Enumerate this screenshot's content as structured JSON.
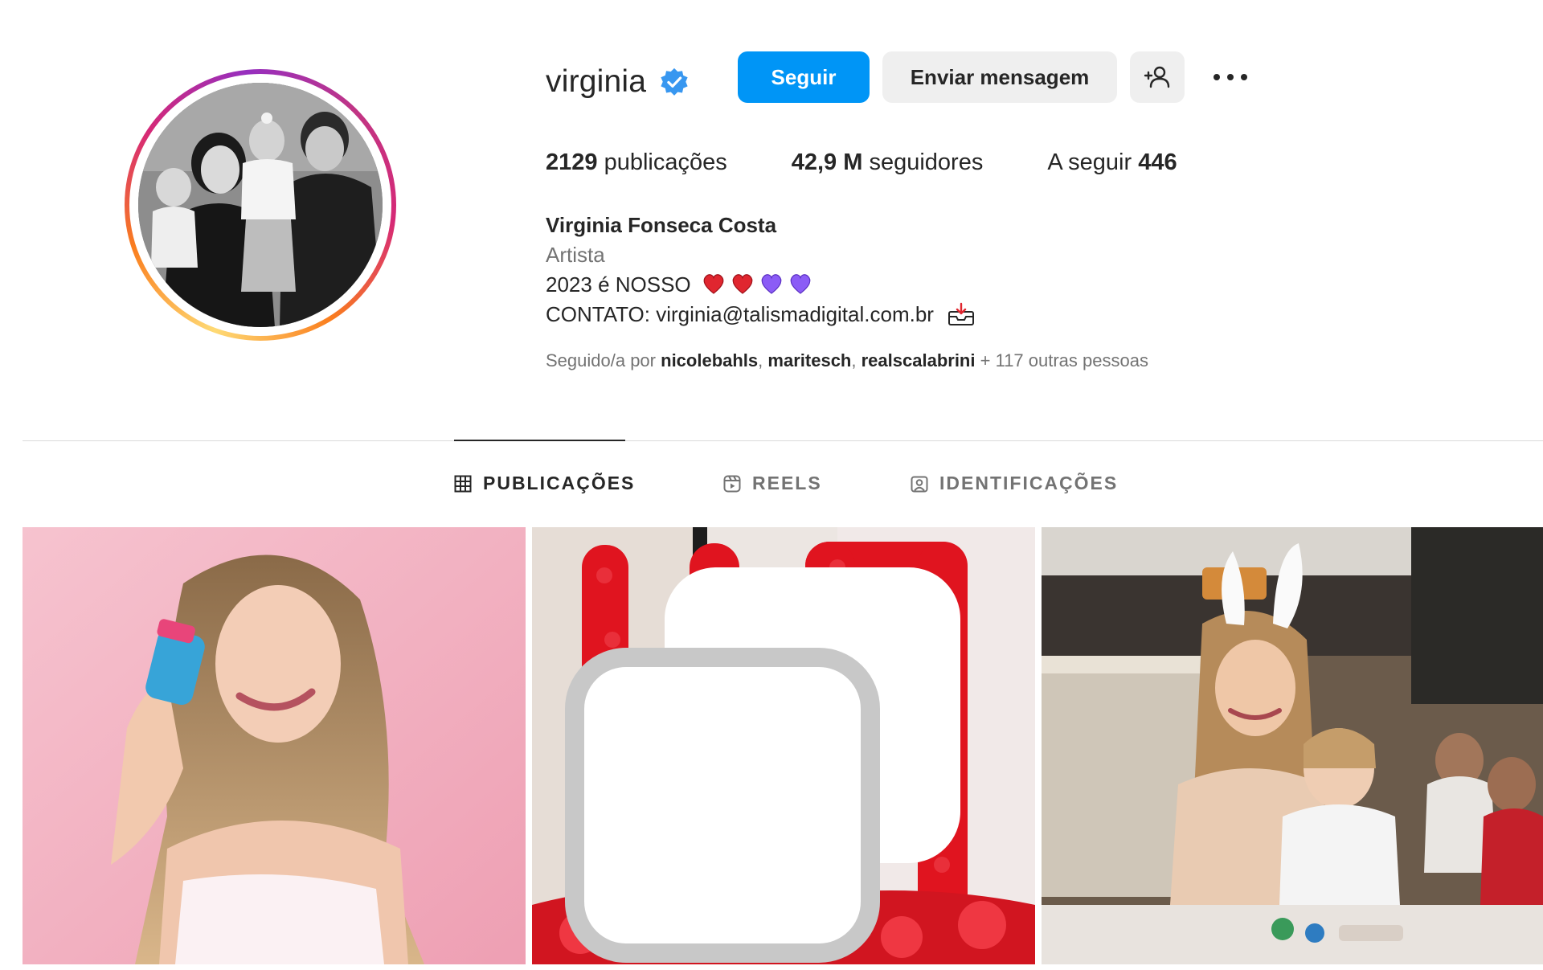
{
  "profile": {
    "username": "virginia",
    "verified": true,
    "full_name": "Virginia Fonseca Costa",
    "category": "Artista",
    "bio_line1": "2023 é NOSSO",
    "bio_contact": "CONTATO: virginia@talismadigital.com.br",
    "avatar_icon": "family-photo-avatar"
  },
  "actions": {
    "follow_label": "Seguir",
    "message_label": "Enviar mensagem",
    "suggest_icon": "add-person-icon",
    "more_icon": "more-options-icon"
  },
  "stats": {
    "posts_count": "2129",
    "posts_label": "publicações",
    "followers_count": "42,9 M",
    "followers_label": "seguidores",
    "following_label": "A seguir",
    "following_count": "446"
  },
  "followed_by": {
    "prefix": "Seguido/a por",
    "user1": "nicolebahls",
    "sep1": ",",
    "user2": "maritesch",
    "sep2": ",",
    "user3": "realscalabrini",
    "suffix": "+ 117 outras pessoas"
  },
  "tabs": [
    {
      "label": "PUBLICAÇÕES",
      "icon": "grid-icon",
      "active": true
    },
    {
      "label": "REELS",
      "icon": "reels-icon",
      "active": false
    },
    {
      "label": "IDENTIFICAÇÕES",
      "icon": "tagged-icon",
      "active": false
    }
  ],
  "posts": [
    {
      "subject": "pink-product-portrait",
      "carousel": false
    },
    {
      "subject": "red-balloon-numbers",
      "carousel": true
    },
    {
      "subject": "family-easter-kitchen",
      "carousel": false
    }
  ],
  "colors": {
    "accent": "#0095f6",
    "text": "#262626",
    "muted": "#737373",
    "button_bg": "#efefef",
    "heart_red": "#e0262f",
    "heart_purple": "#8b5cf6"
  }
}
